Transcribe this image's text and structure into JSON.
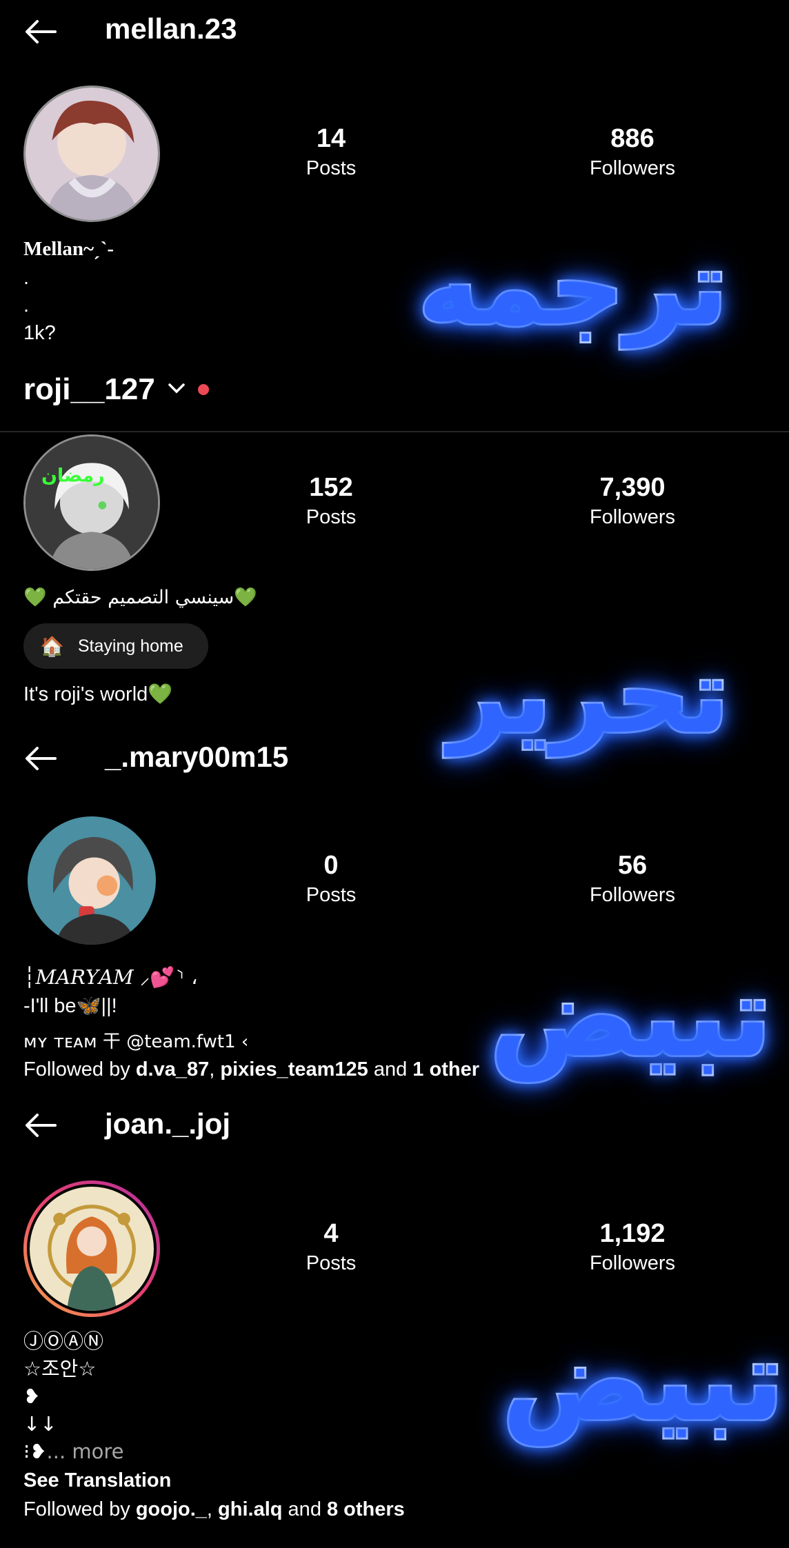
{
  "profile1": {
    "username": "mellan.23",
    "posts": "14",
    "posts_label": "Posts",
    "followers": "886",
    "followers_label": "Followers",
    "bio_name": "Mellan~ˏˋ-",
    "bio_lines": [
      ".",
      ".",
      "1k?"
    ]
  },
  "overlay1": "ترجمه",
  "account_switch": {
    "username": "roji__127",
    "notification_dot_color": "#ed4956"
  },
  "profile2": {
    "posts": "152",
    "posts_label": "Posts",
    "followers": "7,390",
    "followers_label": "Followers",
    "bio_line": "💚سينسي التصميم حقتكم 💚",
    "status_chip": "Staying home",
    "status_icon": "🏠",
    "world": "It's roji's world💚"
  },
  "overlay2": "تحرير",
  "profile3": {
    "username": "_.mary00m15",
    "posts": "0",
    "posts_label": "Posts",
    "followers": "56",
    "followers_label": "Followers",
    "bio_name": "┆𝑀𝐴𝑅𝑌𝐴𝑀 ⸝💕⸃ ،",
    "bio_line2": "-I'll be🦋||!",
    "team_line": "ᴍʏ ᴛᴇᴀᴍ 干 @team.fwt1 ‹",
    "followed_prefix": "Followed by ",
    "followed_user1": "d.va_87",
    "followed_sep": ", ",
    "followed_user2": "pixies_team125",
    "followed_and": " and ",
    "followed_other": "1 other"
  },
  "overlay3": "تبيض",
  "profile4": {
    "username": "joan._.joj",
    "posts": "4",
    "posts_label": "Posts",
    "followers": "1,192",
    "followers_label": "Followers",
    "bio_lines": [
      "ⒿⓄⒶⓃ",
      "☆조안☆",
      "❥",
      "↓↓"
    ],
    "more_prefix": "⁝❥",
    "more_label": "... more",
    "see_translation": "See Translation",
    "followed_prefix": "Followed by ",
    "followed_user1": "goojo._",
    "followed_sep": ", ",
    "followed_user2": "ghi.alq",
    "followed_and": " and ",
    "followed_other": "8 others"
  },
  "overlay4": "تبيض"
}
